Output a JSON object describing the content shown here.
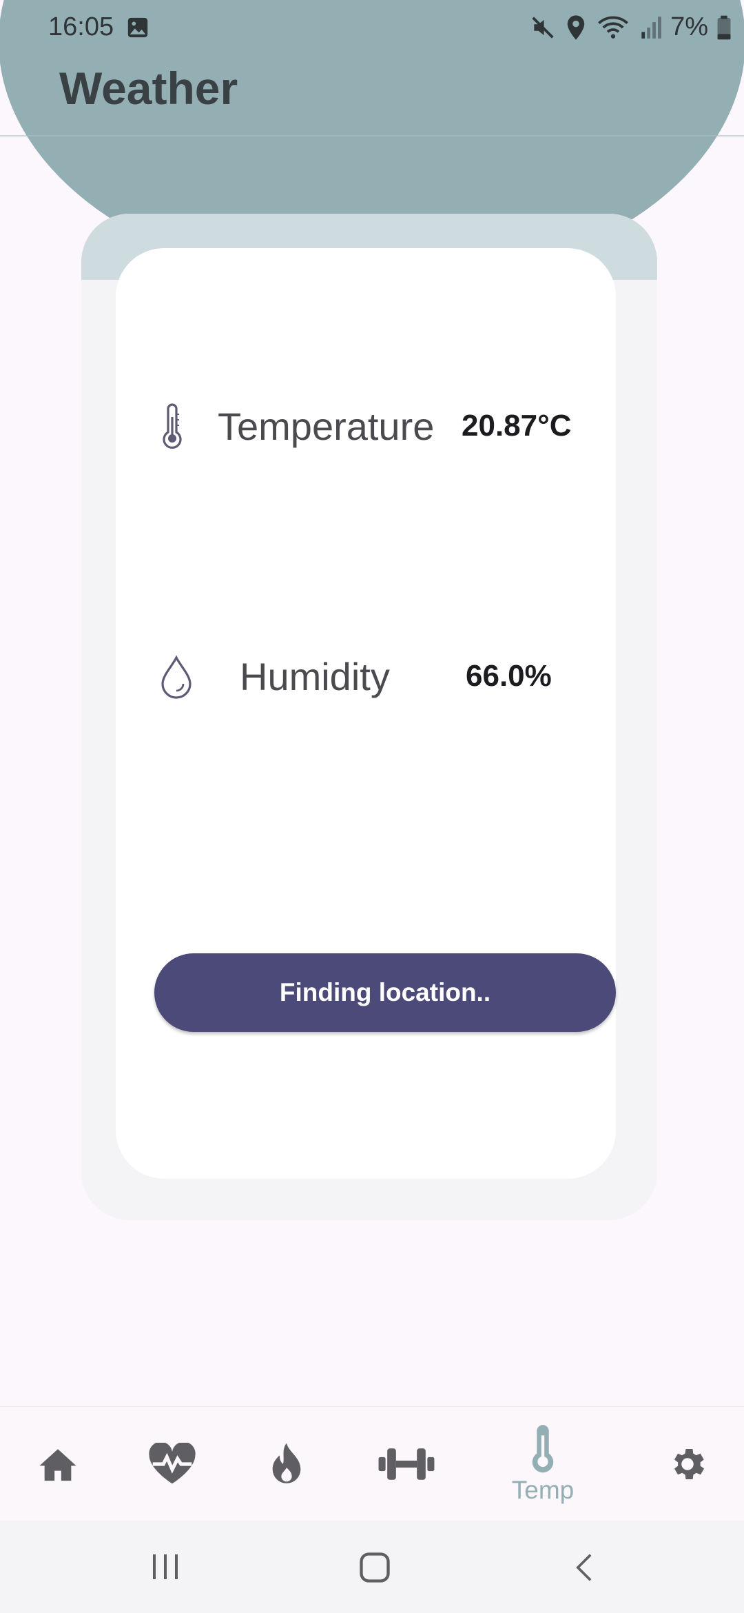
{
  "status_bar": {
    "time": "16:05",
    "battery": "7%",
    "icons": [
      "gallery-icon",
      "mute-icon",
      "location-icon",
      "wifi-icon",
      "signal-icon",
      "battery-icon"
    ]
  },
  "header": {
    "title": "Weather"
  },
  "readings": {
    "temperature": {
      "label": "Temperature",
      "value": "20.87°C",
      "icon": "thermometer-icon"
    },
    "humidity": {
      "label": "Humidity",
      "value": "66.0%",
      "icon": "droplet-icon"
    }
  },
  "location_button": {
    "label": "Finding location.."
  },
  "bottom_nav": {
    "items": [
      {
        "icon": "home-icon",
        "label": ""
      },
      {
        "icon": "heart-pulse-icon",
        "label": ""
      },
      {
        "icon": "flame-icon",
        "label": ""
      },
      {
        "icon": "dumbbell-icon",
        "label": ""
      },
      {
        "icon": "thermometer-icon",
        "label": "Temp",
        "selected": true
      },
      {
        "icon": "gear-icon",
        "label": ""
      }
    ]
  },
  "colors": {
    "header": "#93afb4",
    "button": "#4b4a78",
    "active_nav": "#93afb4",
    "nav_icon": "#5f5f63",
    "background": "#fcf6fd"
  }
}
